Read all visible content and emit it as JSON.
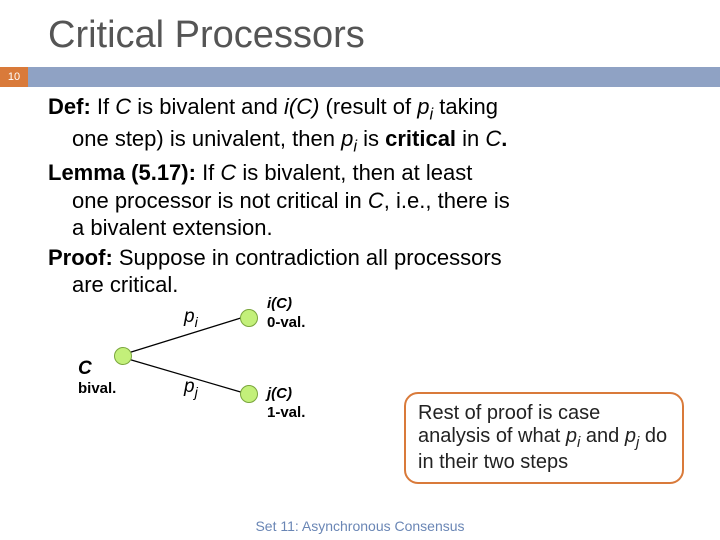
{
  "slide_number": "10",
  "title": "Critical Processors",
  "def_label": "Def:",
  "def_text_1": " If ",
  "def_C": "C",
  "def_text_2": " is bivalent and ",
  "def_iC": "i(C)",
  "def_text_3": " (result of ",
  "def_pi": "p",
  "def_pi_sub": "i",
  "def_text_3b": " taking",
  "def_line2_a": "one step) is univalent, then ",
  "def_line2_b": " is ",
  "def_critical": "critical",
  "def_line2_c": " in ",
  "def_line2_d": ".",
  "lemma_label": "Lemma (5.17):",
  "lemma_text_1": "  If ",
  "lemma_text_2": " is bivalent, then at least",
  "lemma_line2_a": "one processor is not critical in ",
  "lemma_line2_b": ", i.e., there is",
  "lemma_line3": "a bivalent extension.",
  "proof_label": "Proof:",
  "proof_text_1": "  Suppose in contradiction all processors",
  "proof_line2": "are critical.",
  "diag_pi": "p",
  "diag_pi_sub": "i",
  "diag_pj": "p",
  "diag_pj_sub": "j",
  "diag_C": "C",
  "diag_bival": "bival.",
  "diag_iC": "i(C)",
  "diag_0val": "0-val.",
  "diag_jC": "j(C)",
  "diag_1val": "1-val.",
  "note_1": "Rest of proof is case analysis of what ",
  "note_pi": "p",
  "note_pi_sub": "i",
  "note_2": " and ",
  "note_pj": "p",
  "note_pj_sub": "j",
  "note_3": " do in their two steps",
  "footer": "Set 11: Asynchronous Consensus"
}
